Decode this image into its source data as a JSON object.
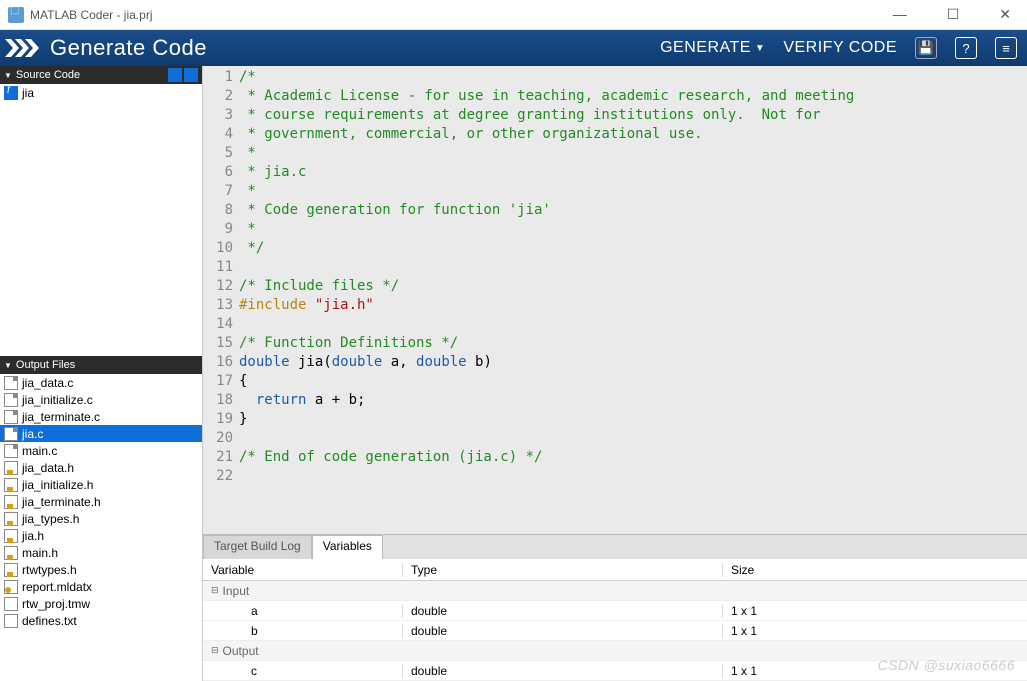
{
  "window": {
    "title": "MATLAB Coder - jia.prj"
  },
  "header": {
    "title": "Generate Code",
    "generate_btn": "GENERATE",
    "verify_btn": "VERIFY CODE"
  },
  "sidebar": {
    "source_panel_title": "Source Code",
    "source_files": [
      {
        "name": "jia",
        "icon": "fn"
      }
    ],
    "output_panel_title": "Output Files",
    "output_files": [
      {
        "name": "jia_data.c",
        "icon": "c"
      },
      {
        "name": "jia_initialize.c",
        "icon": "c"
      },
      {
        "name": "jia_terminate.c",
        "icon": "c"
      },
      {
        "name": "jia.c",
        "icon": "c",
        "selected": true
      },
      {
        "name": "main.c",
        "icon": "c"
      },
      {
        "name": "jia_data.h",
        "icon": "h"
      },
      {
        "name": "jia_initialize.h",
        "icon": "h"
      },
      {
        "name": "jia_terminate.h",
        "icon": "h"
      },
      {
        "name": "jia_types.h",
        "icon": "h"
      },
      {
        "name": "jia.h",
        "icon": "h"
      },
      {
        "name": "main.h",
        "icon": "h"
      },
      {
        "name": "rtwtypes.h",
        "icon": "h"
      },
      {
        "name": "report.mldatx",
        "icon": "rpt"
      },
      {
        "name": "rtw_proj.tmw",
        "icon": "txt"
      },
      {
        "name": "defines.txt",
        "icon": "txt"
      }
    ]
  },
  "editor": {
    "lines": [
      {
        "n": 1,
        "tokens": [
          [
            "comment",
            "/*"
          ]
        ]
      },
      {
        "n": 2,
        "tokens": [
          [
            "comment",
            " * Academic License - for use in teaching, academic research, and meeting"
          ]
        ]
      },
      {
        "n": 3,
        "tokens": [
          [
            "comment",
            " * course requirements at degree granting institutions only.  Not for"
          ]
        ]
      },
      {
        "n": 4,
        "tokens": [
          [
            "comment",
            " * government, commercial, or other organizational use."
          ]
        ]
      },
      {
        "n": 5,
        "tokens": [
          [
            "comment",
            " *"
          ]
        ]
      },
      {
        "n": 6,
        "tokens": [
          [
            "comment",
            " * jia.c"
          ]
        ]
      },
      {
        "n": 7,
        "tokens": [
          [
            "comment",
            " *"
          ]
        ]
      },
      {
        "n": 8,
        "tokens": [
          [
            "comment",
            " * Code generation for function 'jia'"
          ]
        ]
      },
      {
        "n": 9,
        "tokens": [
          [
            "comment",
            " *"
          ]
        ]
      },
      {
        "n": 10,
        "tokens": [
          [
            "comment",
            " */"
          ]
        ]
      },
      {
        "n": 11,
        "tokens": []
      },
      {
        "n": 12,
        "tokens": [
          [
            "comment",
            "/* Include files */"
          ]
        ]
      },
      {
        "n": 13,
        "tokens": [
          [
            "preproc",
            "#include "
          ],
          [
            "string",
            "\"jia.h\""
          ]
        ]
      },
      {
        "n": 14,
        "tokens": []
      },
      {
        "n": 15,
        "tokens": [
          [
            "comment",
            "/* Function Definitions */"
          ]
        ]
      },
      {
        "n": 16,
        "tokens": [
          [
            "type",
            "double"
          ],
          [
            "",
            " jia("
          ],
          [
            "type",
            "double"
          ],
          [
            "",
            " a, "
          ],
          [
            "type",
            "double"
          ],
          [
            "",
            " b)"
          ]
        ]
      },
      {
        "n": 17,
        "tokens": [
          [
            "",
            "{"
          ]
        ]
      },
      {
        "n": 18,
        "tokens": [
          [
            "",
            "  "
          ],
          [
            "keyword",
            "return"
          ],
          [
            "",
            " a + b;"
          ]
        ]
      },
      {
        "n": 19,
        "tokens": [
          [
            "",
            "}"
          ]
        ]
      },
      {
        "n": 20,
        "tokens": []
      },
      {
        "n": 21,
        "tokens": [
          [
            "comment",
            "/* End of code generation (jia.c) */"
          ]
        ]
      },
      {
        "n": 22,
        "tokens": []
      }
    ]
  },
  "bottom_panel": {
    "tabs": [
      {
        "label": "Target Build Log",
        "active": false
      },
      {
        "label": "Variables",
        "active": true
      }
    ],
    "columns": {
      "variable": "Variable",
      "type": "Type",
      "size": "Size"
    },
    "groups": [
      {
        "name": "Input",
        "rows": [
          {
            "name": "a",
            "type": "double",
            "size": "1 x 1"
          },
          {
            "name": "b",
            "type": "double",
            "size": "1 x 1"
          }
        ]
      },
      {
        "name": "Output",
        "rows": [
          {
            "name": "c",
            "type": "double",
            "size": "1 x 1"
          }
        ]
      }
    ]
  },
  "watermark": "CSDN @suxiao6666"
}
